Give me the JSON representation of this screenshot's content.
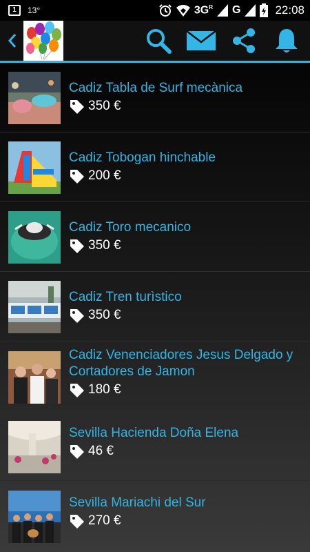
{
  "status_bar": {
    "notification_count": "1",
    "temperature": "13°",
    "network": "3G",
    "network_sup": "R",
    "network2": "G",
    "time": "22:08"
  },
  "action_bar": {
    "icons": [
      "back-icon",
      "search-icon",
      "mail-icon",
      "share-icon",
      "bell-icon"
    ],
    "accent_color": "#33b5e5"
  },
  "items": [
    {
      "title": "Cadiz Tabla de Surf mecànica",
      "price": "350 €"
    },
    {
      "title": "Cadiz Tobogan hinchable",
      "price": "200 €"
    },
    {
      "title": "Cadiz Toro mecanico",
      "price": "350 €"
    },
    {
      "title": "Cadiz Tren turìstico",
      "price": "350 €"
    },
    {
      "title": "Cadiz Venenciadores Jesus Delgado y Cortadores de Jamon",
      "price": "180 €"
    },
    {
      "title": "Sevilla Hacienda Doña Elena",
      "price": "46 €"
    },
    {
      "title": "Sevilla Mariachi del Sur",
      "price": "270 €"
    }
  ]
}
